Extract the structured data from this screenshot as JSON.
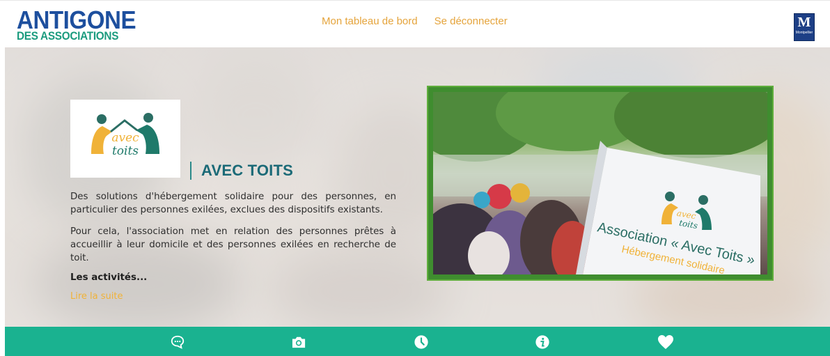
{
  "header": {
    "logo_line1": "ANTIGONE",
    "logo_line2": "DES ASSOCIATIONS",
    "nav": [
      {
        "label": "Mon tableau de bord"
      },
      {
        "label": "Se déconnecter"
      }
    ],
    "city_badge_letter": "M",
    "city_badge_text": "Montpellier"
  },
  "association": {
    "logo_text": "avec toits",
    "name": "AVEC TOITS",
    "description_1": "Des solutions d'hébergement solidaire pour des personnes, en particulier des personnes exilées, exclues des dispositifs existants.",
    "description_2": "Pour cela, l'association met en relation des personnes prêtes à accueillir à leur domicile et des personnes exilées en recherche de toit.",
    "activities_label": "Les activités...",
    "read_more_label": "Lire la suite"
  },
  "photo": {
    "banner_line1": "Association « Avec Toits »",
    "banner_line2": "Hébergement solidaire"
  },
  "bottom_tabs": [
    {
      "icon": "chat-icon"
    },
    {
      "icon": "camera-icon"
    },
    {
      "icon": "clock-icon"
    },
    {
      "icon": "info-icon"
    },
    {
      "icon": "heart-icon"
    }
  ],
  "colors": {
    "brand_blue": "#1d4f9e",
    "brand_green": "#1b9b7e",
    "nav_accent": "#e5a43c",
    "bottom_bar": "#1ab290",
    "title": "#1b6a77"
  }
}
